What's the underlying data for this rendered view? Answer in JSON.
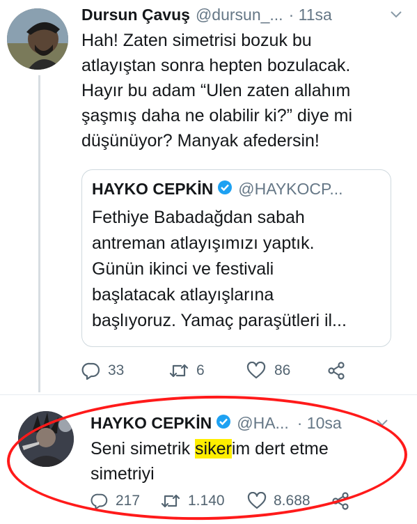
{
  "tweet1": {
    "display_name": "Dursun Çavuş",
    "handle": "@dursun_...",
    "time": "· 11sa",
    "body": "Hah! Zaten simetrisi bozuk bu atlayıştan sonra hepten bozulacak. Hayır bu adam “Ulen zaten allahım şaşmış daha ne olabilir ki?” diye mi düşünüyor? Manyak afedersin!",
    "lines": [
      "Hah! Zaten simetrisi bozuk bu",
      "atlayıştan sonra hepten bozulacak.",
      "Hayır bu adam “Ulen zaten allahım",
      "şaşmış daha ne olabilir ki?” diye mi",
      "düşünüyor? Manyak afedersin!"
    ],
    "quote": {
      "display_name": "HAYKO CEPKİN",
      "handle": "@HAYKOCP...",
      "lines": [
        "Fethiye Babadağdan sabah",
        "antreman atlayışımızı yaptık.",
        "Günün ikinci ve festivali",
        "başlatacak atlayışlarına",
        "başlıyoruz. Yamaç paraşütleri il..."
      ]
    },
    "actions": {
      "replies": "33",
      "retweets": "6",
      "likes": "86"
    }
  },
  "tweet2": {
    "display_name": "HAYKO CEPKİN",
    "handle": "@HA...",
    "time": "· 10sa",
    "line1_pre": "Seni simetrik ",
    "line1_highlight": "siker",
    "line1_post": "im dert etme",
    "line2": "simetriyi",
    "actions": {
      "replies": "217",
      "retweets": "1.140",
      "likes": "8.688"
    }
  },
  "colors": {
    "verified_blue": "#1da1f2",
    "annotation_red": "#ff1a1a",
    "highlight_yellow": "#ffee00"
  }
}
